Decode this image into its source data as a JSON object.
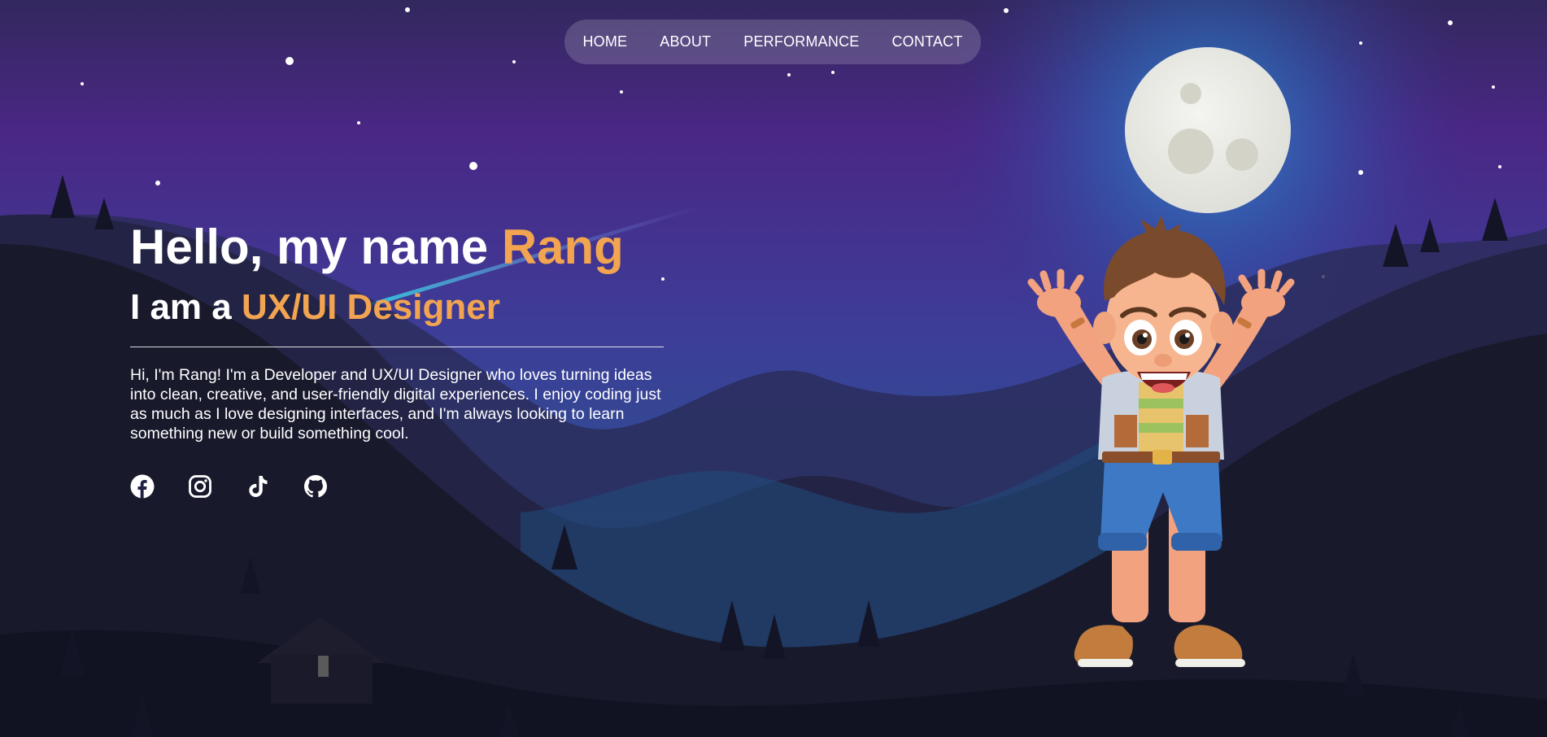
{
  "nav": {
    "items": [
      {
        "label": "HOME"
      },
      {
        "label": "ABOUT"
      },
      {
        "label": "PERFORMANCE"
      },
      {
        "label": "CONTACT"
      }
    ]
  },
  "hero": {
    "greeting_prefix": "Hello, my name ",
    "name": "Rang",
    "role_prefix": "I am a ",
    "role": "UX/UI Designer",
    "bio": "Hi, I'm Rang! I'm a Developer and UX/UI Designer who loves turning ideas into clean, creative, and user-friendly digital experiences. I enjoy coding just as much as I love designing interfaces, and I'm always looking to learn something new or build something cool."
  },
  "socials": [
    {
      "icon": "facebook-icon"
    },
    {
      "icon": "instagram-icon"
    },
    {
      "icon": "tiktok-icon"
    },
    {
      "icon": "github-icon"
    }
  ],
  "colors": {
    "accent": "#f2a450",
    "sky_top": "#3b2a7a",
    "ground": "#16172a"
  }
}
